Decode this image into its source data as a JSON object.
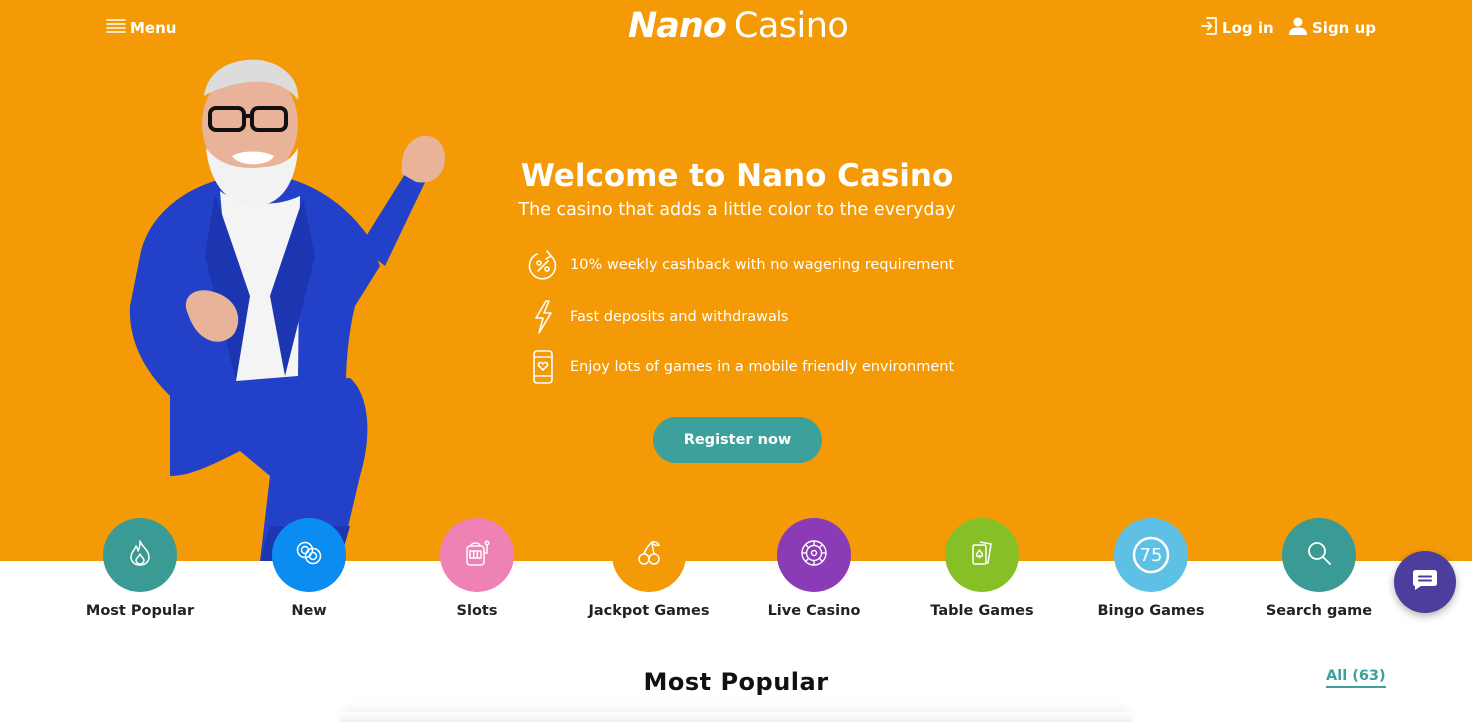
{
  "header": {
    "menu_label": "Menu",
    "logo": {
      "part1": "Nano",
      "part2": "Casino"
    },
    "login_label": "Log in",
    "signup_label": "Sign up"
  },
  "hero": {
    "title": "Welcome to Nano Casino",
    "subtitle": "The casino that adds a little color to the everyday",
    "features": [
      {
        "icon": "cashback-percent-icon",
        "text": "10% weekly cashback with no wagering requirement"
      },
      {
        "icon": "lightning-icon",
        "text": "Fast deposits and withdrawals"
      },
      {
        "icon": "mobile-phone-icon",
        "text": "Enjoy lots of games in a mobile friendly environment"
      }
    ],
    "register_label": "Register now"
  },
  "categories": [
    {
      "label": "Most Popular",
      "icon": "flame-icon",
      "color": "#3a9a94"
    },
    {
      "label": "New",
      "icon": "chips-icon",
      "color": "#0a8cf0"
    },
    {
      "label": "Slots",
      "icon": "slot-machine-icon",
      "color": "#ef82b4"
    },
    {
      "label": "Jackpot Games",
      "icon": "cherries-icon",
      "color": "#f39a06"
    },
    {
      "label": "Live Casino",
      "icon": "roulette-icon",
      "color": "#8b3bb5"
    },
    {
      "label": "Table Games",
      "icon": "cards-icon",
      "color": "#86bf26"
    },
    {
      "label": "Bingo Games",
      "icon": "bingo-ball-icon",
      "color": "#5fc0e6",
      "badge": "75"
    },
    {
      "label": "Search game",
      "icon": "search-icon",
      "color": "#3a9a94"
    }
  ],
  "section": {
    "title": "Most Popular",
    "all_link": "All (63)"
  },
  "colors": {
    "hero_bg": "#f39a06",
    "accent": "#3ea09b",
    "chat_bg": "#4b3e9c"
  }
}
